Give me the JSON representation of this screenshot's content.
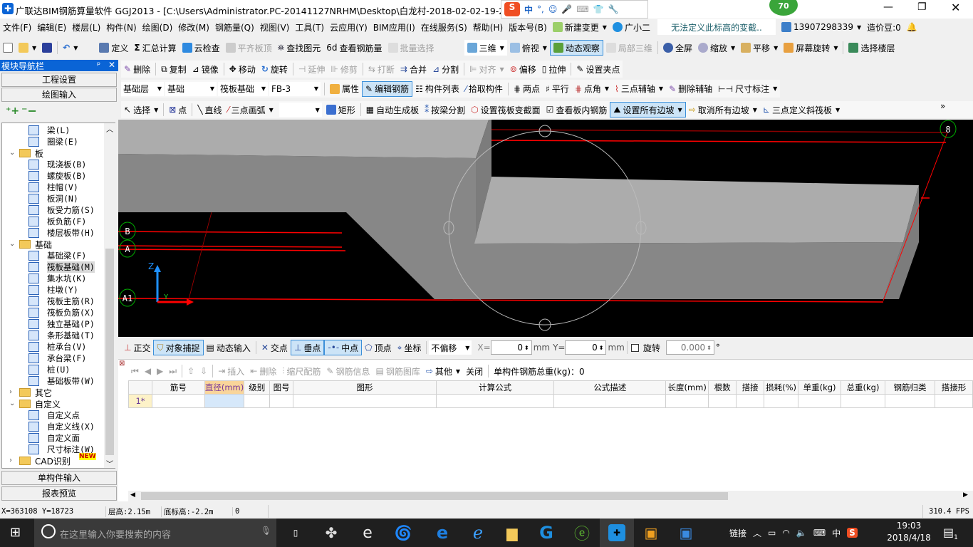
{
  "window": {
    "title": "广联达BIM钢筋算量软件 GGJ2013 - [C:\\Users\\Administrator.PC-20141127NRHM\\Desktop\\白龙村-2018-02-02-19-24-35",
    "badge": "70",
    "ime_label": "中",
    "accent": "#0a64d6"
  },
  "menu": [
    "文件(F)",
    "编辑(E)",
    "楼层(L)",
    "构件(N)",
    "绘图(D)",
    "修改(M)",
    "钢筋量(Q)",
    "视图(V)",
    "工具(T)",
    "云应用(Y)",
    "BIM应用(I)",
    "在线服务(S)",
    "帮助(H)",
    "版本号(B)"
  ],
  "menu_right": {
    "new_change": "新建变更",
    "assistant": "广小二",
    "notice": "无法定义此标高的变截..",
    "phone": "13907298339",
    "beans": "造价豆:0"
  },
  "toolbar1": [
    "定义",
    "汇总计算",
    "云检查",
    "平齐板顶",
    "查找图元",
    "查看钢筋量",
    "批量选择"
  ],
  "toolbar1_right": [
    "三维",
    "俯视",
    "动态观察",
    "局部三维",
    "全屏",
    "缩放",
    "平移",
    "屏幕旋转",
    "选择楼层"
  ],
  "toolbar2": [
    "删除",
    "复制",
    "镜像",
    "移动",
    "旋转",
    "延伸",
    "修剪",
    "打断",
    "合并",
    "分割",
    "对齐",
    "偏移",
    "拉伸",
    "设置夹点"
  ],
  "selectors": [
    "基础层",
    "基础",
    "筏板基础",
    "FB-3"
  ],
  "toolbar3": [
    "属性",
    "编辑钢筋",
    "构件列表",
    "拾取构件",
    "两点",
    "平行",
    "点角",
    "三点辅轴",
    "删除辅轴",
    "尺寸标注"
  ],
  "toolbar4": [
    "选择",
    "点",
    "直线",
    "三点画弧",
    "矩形",
    "自动生成板",
    "按梁分割",
    "设置筏板变截面",
    "查看板内钢筋",
    "设置所有边坡",
    "取消所有边坡",
    "三点定义斜筏板"
  ],
  "nav": {
    "title": "模块导航栏",
    "tabs_top": [
      "工程设置",
      "绘图输入"
    ],
    "tabs_bottom": [
      "单构件输入",
      "报表预览"
    ],
    "items": [
      {
        "label": "梁(L)",
        "type": "item"
      },
      {
        "label": "圈梁(E)",
        "type": "item"
      },
      {
        "label": "板",
        "type": "group"
      },
      {
        "label": "现浇板(B)",
        "type": "item"
      },
      {
        "label": "螺旋板(B)",
        "type": "item"
      },
      {
        "label": "柱帽(V)",
        "type": "item"
      },
      {
        "label": "板洞(N)",
        "type": "item"
      },
      {
        "label": "板受力筋(S)",
        "type": "item"
      },
      {
        "label": "板负筋(F)",
        "type": "item"
      },
      {
        "label": "楼层板带(H)",
        "type": "item"
      },
      {
        "label": "基础",
        "type": "group"
      },
      {
        "label": "基础梁(F)",
        "type": "item"
      },
      {
        "label": "筏板基础(M)",
        "type": "item",
        "selected": true
      },
      {
        "label": "集水坑(K)",
        "type": "item"
      },
      {
        "label": "柱墩(Y)",
        "type": "item"
      },
      {
        "label": "筏板主筋(R)",
        "type": "item"
      },
      {
        "label": "筏板负筋(X)",
        "type": "item"
      },
      {
        "label": "独立基础(P)",
        "type": "item"
      },
      {
        "label": "条形基础(T)",
        "type": "item"
      },
      {
        "label": "桩承台(V)",
        "type": "item"
      },
      {
        "label": "承台梁(F)",
        "type": "item"
      },
      {
        "label": "桩(U)",
        "type": "item"
      },
      {
        "label": "基础板带(W)",
        "type": "item"
      },
      {
        "label": "其它",
        "type": "group",
        "collapsed": true
      },
      {
        "label": "自定义",
        "type": "group"
      },
      {
        "label": "自定义点",
        "type": "item"
      },
      {
        "label": "自定义线(X)",
        "type": "item"
      },
      {
        "label": "自定义面",
        "type": "item"
      },
      {
        "label": "尺寸标注(W)",
        "type": "item"
      },
      {
        "label": "CAD识别",
        "type": "group",
        "collapsed": true,
        "badge": "NEW"
      }
    ]
  },
  "viewport": {
    "axis_labels": [
      "B",
      "A",
      "A1",
      "8"
    ],
    "axis_z": "Z",
    "axis_y": "Y"
  },
  "snapbar": {
    "items": [
      "正交",
      "对象捕捉",
      "动态输入",
      "交点",
      "垂点",
      "中点",
      "顶点",
      "坐标"
    ],
    "offset": "不偏移",
    "x_label": "X=",
    "x_value": "0",
    "y_label": "Y=",
    "y_value": "0",
    "unit": "mm",
    "rotate_label": "旋转",
    "rotate_value": "0.000",
    "deg": "°"
  },
  "gridbar": {
    "items": [
      "插入",
      "删除",
      "缩尺配筋",
      "钢筋信息",
      "钢筋图库",
      "其他",
      "关闭"
    ],
    "total": "单构件钢筋总重(kg)：0"
  },
  "table": {
    "columns": [
      "",
      "筋号",
      "直径(mm)",
      "级别",
      "图号",
      "图形",
      "计算公式",
      "公式描述",
      "长度(mm)",
      "根数",
      "搭接",
      "损耗(%)",
      "单重(kg)",
      "总重(kg)",
      "钢筋归类",
      "搭接形"
    ],
    "rows": [
      [
        "1*",
        "",
        "",
        "",
        "",
        "",
        "",
        "",
        "",
        "",
        "",
        "",
        "",
        "",
        "",
        ""
      ]
    ]
  },
  "status": {
    "coords": "X=363108 Y=18723",
    "floor_height": "层高:2.15m",
    "base_height": "底标高:-2.2m",
    "value": "0",
    "fps": "310.4 FPS"
  },
  "taskbar": {
    "search_placeholder": "在这里输入你要搜索的内容",
    "link": "链接",
    "ime": "中",
    "time": "19:03",
    "date": "2018/4/18",
    "notifications": "1"
  }
}
